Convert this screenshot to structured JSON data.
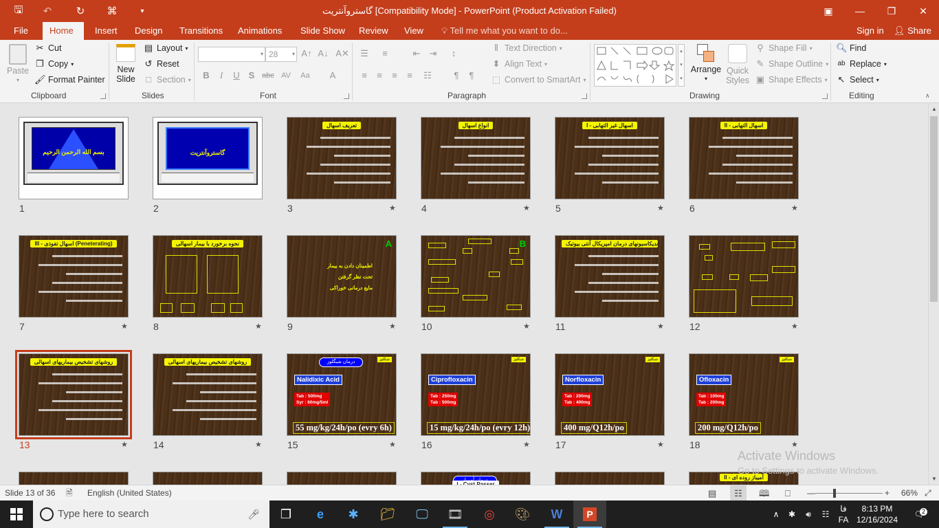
{
  "titlebar": {
    "title": "گاستروآنتریت [Compatibility Mode] - PowerPoint (Product Activation Failed)",
    "icons": [
      "save-icon",
      "undo-icon",
      "redo-icon",
      "slideshow-start-icon",
      "qat-dropdown-icon"
    ]
  },
  "tabs": {
    "file": "File",
    "items": [
      "Home",
      "Insert",
      "Design",
      "Transitions",
      "Animations",
      "Slide Show",
      "Review",
      "View"
    ],
    "tell_me": "Tell me what you want to do...",
    "sign_in": "Sign in",
    "share": "Share"
  },
  "ribbon": {
    "clipboard": {
      "label": "Clipboard",
      "paste": "Paste",
      "cut": "Cut",
      "copy": "Copy",
      "format_painter": "Format Painter"
    },
    "slides": {
      "label": "Slides",
      "new_slide_1": "New",
      "new_slide_2": "Slide",
      "layout": "Layout",
      "reset": "Reset",
      "section": "Section"
    },
    "font": {
      "label": "Font",
      "font_size": "28"
    },
    "paragraph": {
      "label": "Paragraph",
      "text_direction": "Text Direction",
      "align_text": "Align Text",
      "smartart": "Convert to SmartArt"
    },
    "drawing": {
      "label": "Drawing",
      "arrange": "Arrange",
      "quick_1": "Quick",
      "quick_2": "Styles",
      "fill": "Shape Fill",
      "outline": "Shape Outline",
      "effects": "Shape Effects"
    },
    "editing": {
      "label": "Editing",
      "find": "Find",
      "replace": "Replace",
      "select": "Select"
    }
  },
  "slides": [
    {
      "n": "1",
      "kind": "monitor",
      "text": "بسم الله الرحمن الرحیم"
    },
    {
      "n": "2",
      "kind": "monitor",
      "text": "گاستروآنتریت"
    },
    {
      "n": "3",
      "title": "تعریف اسهال"
    },
    {
      "n": "4",
      "title": "انواع اسهال"
    },
    {
      "n": "5",
      "title": "I - اسهال غیر التهابی"
    },
    {
      "n": "6",
      "title": "II - اسهال التهابی"
    },
    {
      "n": "7",
      "title": "III - اسهال تفوذی (Peneterating)"
    },
    {
      "n": "8",
      "title": "نحوه برخورد با بیمار اسهالی"
    },
    {
      "n": "9",
      "title": "",
      "letter": "A",
      "bullets": [
        "اطمینان دادن به بیمار",
        "تحت نظر گرفتن",
        "مایع درمانی خوراکی"
      ]
    },
    {
      "n": "10",
      "title": "",
      "letter": "B"
    },
    {
      "n": "11",
      "title": "اندیکاسیونهای درمان امپریکال آنتی بیوتیک"
    },
    {
      "n": "12",
      "title": ""
    },
    {
      "n": "13",
      "title": "روشهای تشخیص بیماریهای اسهالی"
    },
    {
      "n": "14",
      "title": "روشهای تشخیص بیماریهای اسهالی",
      "sub": "مواد غذایی که باید مصرف شود :"
    },
    {
      "n": "15",
      "pill": "درمان شیگلوز",
      "tag": "شیگلوز",
      "drug": "Nalidixic Acid",
      "doses": [
        "Tab : 500mg",
        "Syr : 60mg/5ml"
      ],
      "dose": "55 mg/kg/24h/po (evry 6h)"
    },
    {
      "n": "16",
      "tag": "شیگلوز",
      "drug": "Ciprofloxacin",
      "doses": [
        "Tab : 250mg",
        "Tab : 500mg"
      ],
      "dose": "15 mg/kg/24h/po (evry 12h)"
    },
    {
      "n": "17",
      "tag": "شیگلوز",
      "drug": "Norfloxacin",
      "doses": [
        "Tab : 200mg",
        "Tab : 400mg"
      ],
      "dose": "400 mg/Q12h/po"
    },
    {
      "n": "18",
      "tag": "شیگلوز",
      "drug": "Ofloxacin",
      "doses": [
        "Tab : 100mg",
        "Tab : 200mg"
      ],
      "dose": "200 mg/Q12h/po"
    }
  ],
  "partial": [
    {
      "title": ""
    },
    {
      "title": ""
    },
    {
      "title": ""
    },
    {
      "title": "I - Cyst Passer",
      "pill": "درمان آمیبیاز"
    },
    {
      "title": ""
    },
    {
      "title": "II - آمیباز روده ای"
    }
  ],
  "watermark": {
    "line1": "Activate Windows",
    "line2": "Go to Settings to activate Windows."
  },
  "status": {
    "slide": "Slide 13 of 36",
    "language": "English (United States)",
    "zoom": "66%"
  },
  "taskbar": {
    "search": "Type here to search",
    "time": "8:13 PM",
    "date": "12/16/2024",
    "lang": "FA",
    "ime": "فا",
    "notifications": "2"
  }
}
